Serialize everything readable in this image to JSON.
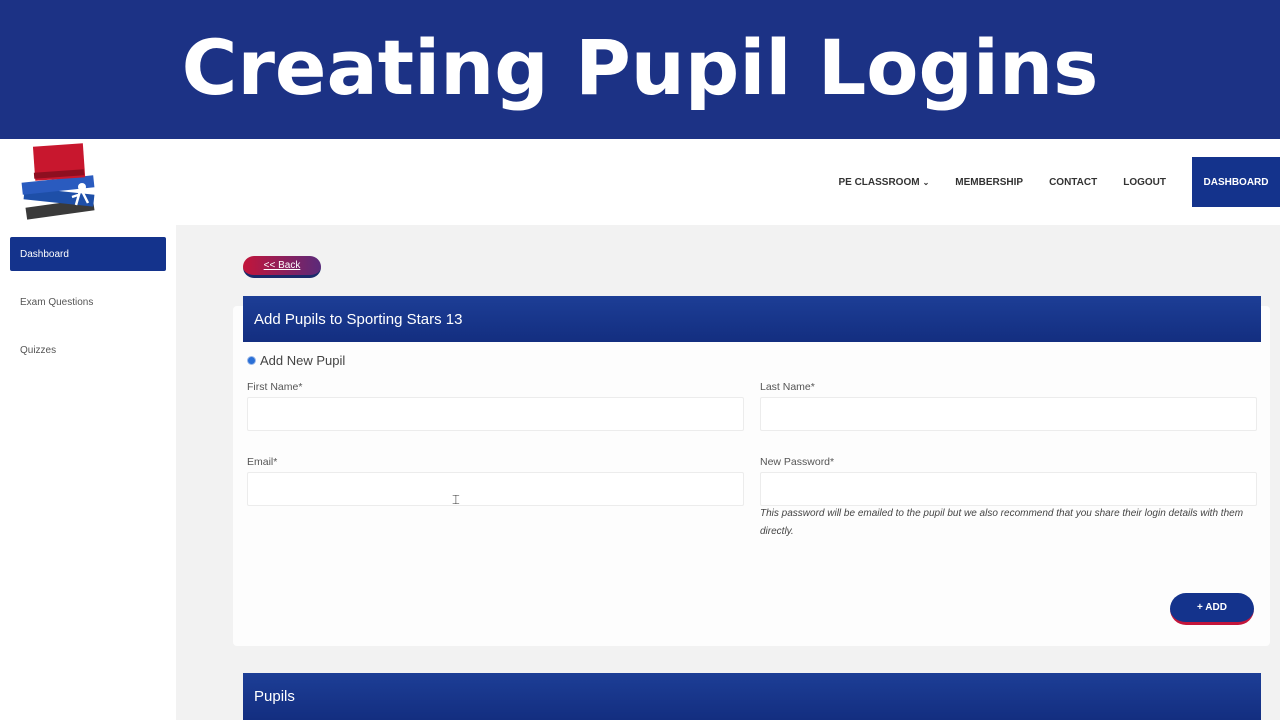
{
  "banner": {
    "title": "Creating Pupil Logins",
    "color": "#1c3285"
  },
  "header": {
    "logo_icon": "books-logo-icon",
    "nav": [
      {
        "label": "PE CLASSROOM",
        "has_dropdown": true
      },
      {
        "label": "MEMBERSHIP"
      },
      {
        "label": "CONTACT"
      },
      {
        "label": "LOGOUT"
      },
      {
        "label": "DASHBOARD",
        "highlight": true
      }
    ]
  },
  "sidebar": {
    "items": [
      {
        "label": "Dashboard",
        "active": true
      },
      {
        "label": "Exam Questions"
      },
      {
        "label": "Quizzes"
      }
    ]
  },
  "back_button": {
    "label": "<< Back"
  },
  "form": {
    "title": "Add Pupils to Sporting Stars 13",
    "radio_label": "Add New Pupil",
    "first_name": {
      "label": "First Name*",
      "value": ""
    },
    "last_name": {
      "label": "Last Name*",
      "value": ""
    },
    "email": {
      "label": "Email*",
      "value": ""
    },
    "password": {
      "label": "New Password*",
      "value": ""
    },
    "help_text": "This password will be emailed to the pupil but we also recommend that you share their login details with them directly.",
    "add_label": "+ ADD"
  },
  "pupils_section": {
    "title": "Pupils"
  },
  "colors": {
    "primary": "#14338c",
    "accent": "#c3153a"
  }
}
